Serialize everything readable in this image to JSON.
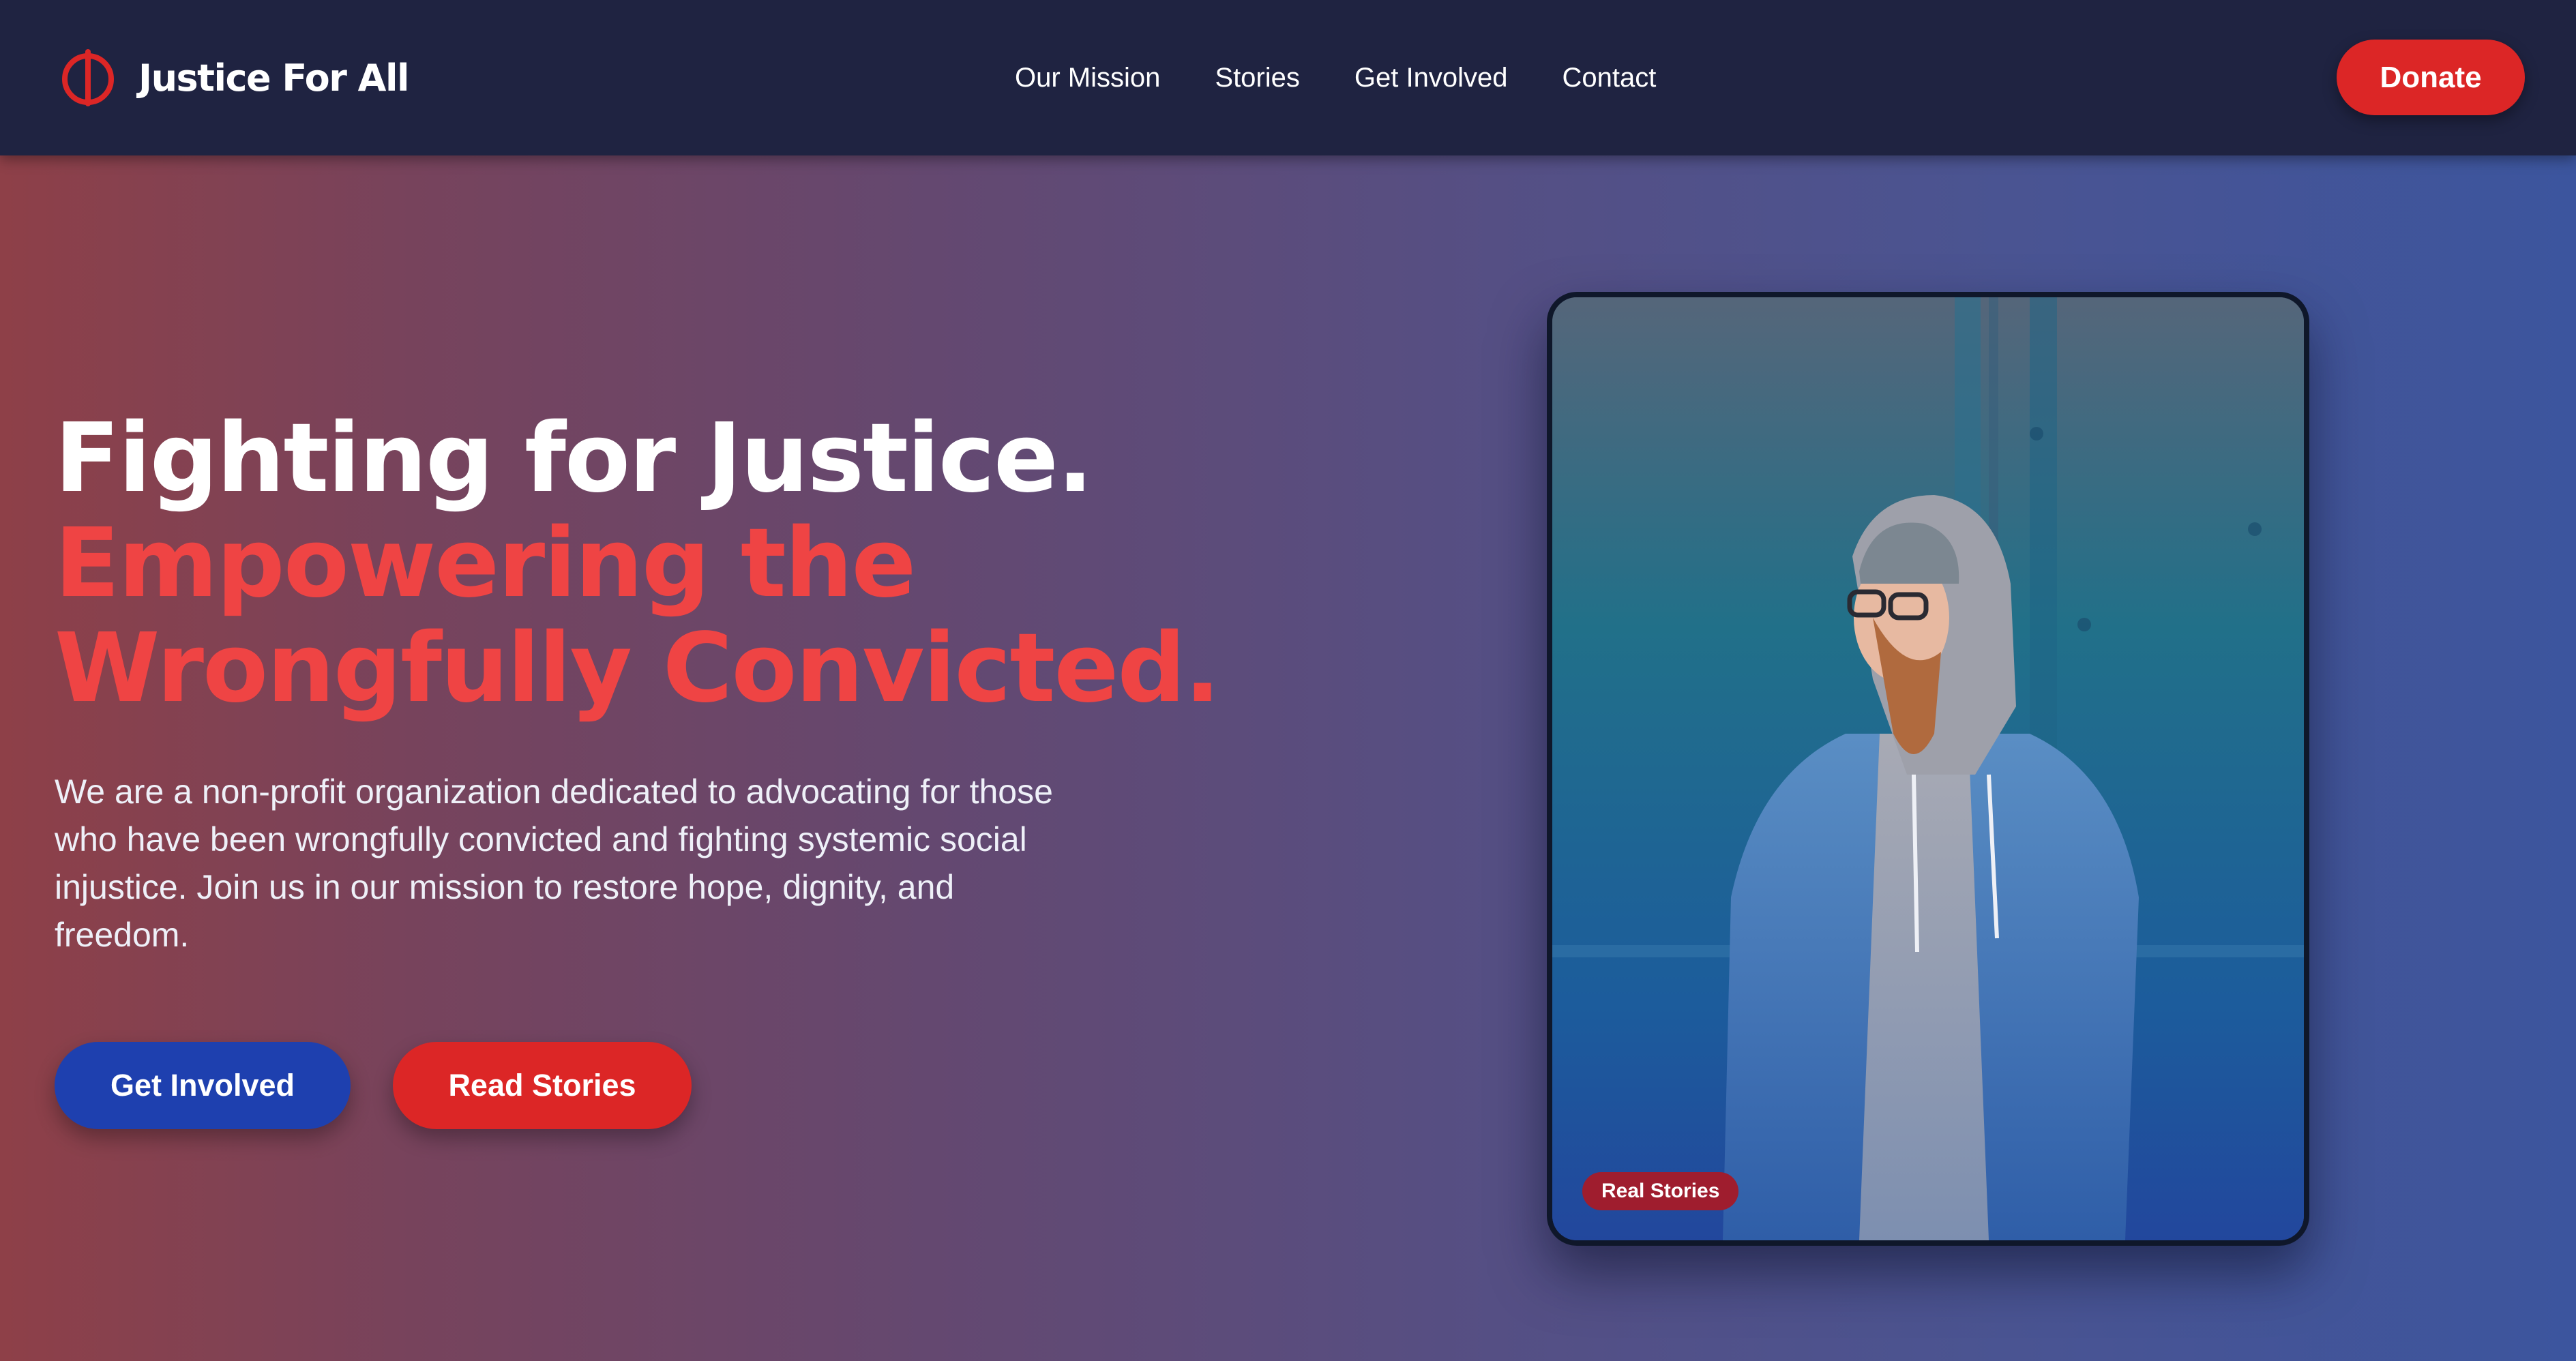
{
  "nav": {
    "brand_name": "Justice For All",
    "logo_icon": "power-symbol-icon",
    "links": [
      "Our Mission",
      "Stories",
      "Get Involved",
      "Contact"
    ],
    "donate_label": "Donate"
  },
  "hero": {
    "headline_line1": "Fighting for Justice.",
    "headline_highlight": "Empowering the Wrongfully Convicted.",
    "description": "We are a non-profit organization dedicated to advocating for those who have been wrongfully convicted and fighting systemic social injustice. Join us in our mission to restore hope, dignity, and freedom.",
    "primary_cta": "Get Involved",
    "secondary_cta": "Read Stories",
    "photo_badge": "Real Stories"
  },
  "colors": {
    "nav_background": "#1f2341",
    "accent_red": "#dc2626",
    "headline_red": "#ef4444",
    "primary_blue": "#1e40af",
    "hero_gradient_start": "#8e4048",
    "hero_gradient_end": "#3c559e"
  }
}
